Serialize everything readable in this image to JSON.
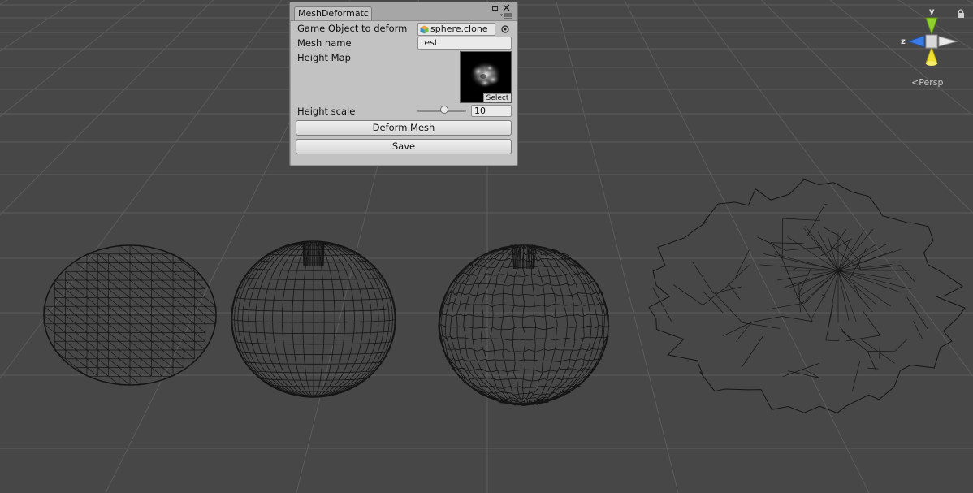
{
  "scene_view": {
    "background": "#474747",
    "grid_color": "#5c5c5c",
    "wire_color": "#151515",
    "persp_label": "Persp",
    "gizmo": {
      "y_label": "y",
      "z_label": "z",
      "y_color": "#8fd12b",
      "z_color": "#3a7be6",
      "x_color": "#e8e8e8",
      "yneg_color": "#f0e030"
    }
  },
  "mesh_deformation_window": {
    "tab_title": "MeshDeformatc",
    "fields": {
      "game_object_label": "Game Object to deform",
      "game_object_value": "sphere.clone",
      "mesh_name_label": "Mesh name",
      "mesh_name_value": "test",
      "height_map_label": "Height Map",
      "height_map_select": "Select",
      "height_scale_label": "Height scale",
      "height_scale_value": "10",
      "height_scale_slider_fraction": 0.55
    },
    "buttons": {
      "deform_mesh": "Deform Mesh",
      "save": "Save"
    }
  }
}
